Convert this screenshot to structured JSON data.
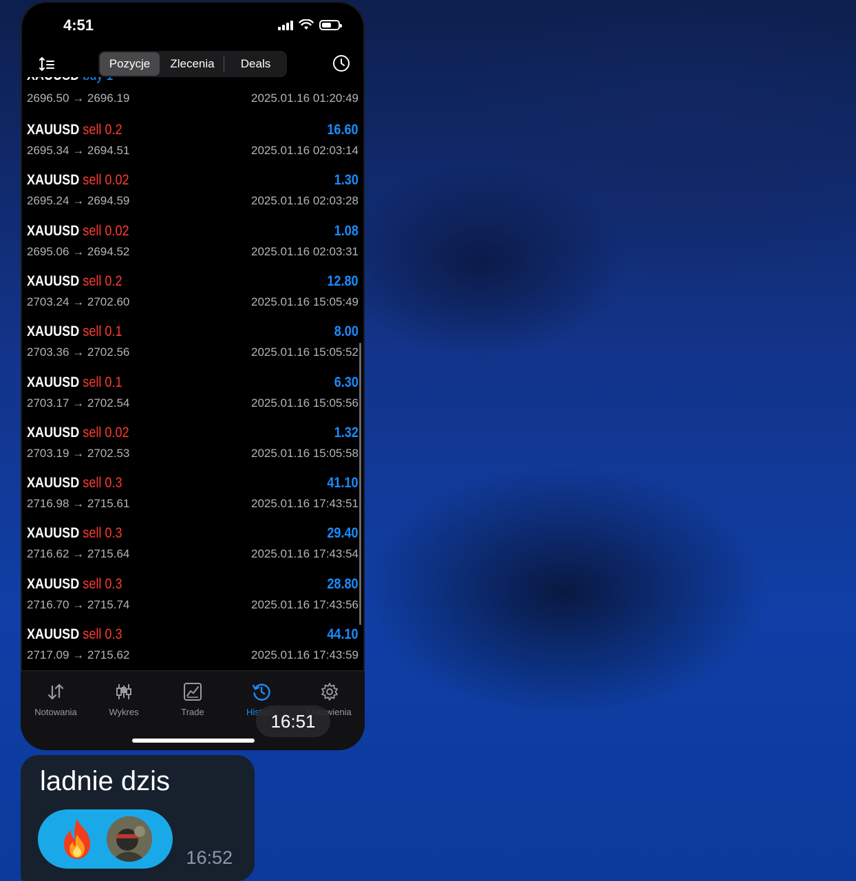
{
  "status_bar": {
    "time": "4:51"
  },
  "tabs": {
    "positions": "Pozycje",
    "orders": "Zlecenia",
    "deals": "Deals",
    "active": "Pozycje"
  },
  "trades": [
    {
      "symbol": "XAUUSD",
      "side": "sell",
      "volume": "0.2",
      "profit": "16.60",
      "prices": "2695.34 → 2694.51",
      "time": "2025.01.16 02:03:14"
    },
    {
      "symbol": "XAUUSD",
      "side": "sell",
      "volume": "0.02",
      "profit": "1.30",
      "prices": "2695.24 → 2694.59",
      "time": "2025.01.16 02:03:28"
    },
    {
      "symbol": "XAUUSD",
      "side": "sell",
      "volume": "0.02",
      "profit": "1.08",
      "prices": "2695.06 → 2694.52",
      "time": "2025.01.16 02:03:31"
    },
    {
      "symbol": "XAUUSD",
      "side": "sell",
      "volume": "0.2",
      "profit": "12.80",
      "prices": "2703.24 → 2702.60",
      "time": "2025.01.16 15:05:49"
    },
    {
      "symbol": "XAUUSD",
      "side": "sell",
      "volume": "0.1",
      "profit": "8.00",
      "prices": "2703.36 → 2702.56",
      "time": "2025.01.16 15:05:52"
    },
    {
      "symbol": "XAUUSD",
      "side": "sell",
      "volume": "0.1",
      "profit": "6.30",
      "prices": "2703.17 → 2702.54",
      "time": "2025.01.16 15:05:56"
    },
    {
      "symbol": "XAUUSD",
      "side": "sell",
      "volume": "0.02",
      "profit": "1.32",
      "prices": "2703.19 → 2702.53",
      "time": "2025.01.16 15:05:58"
    },
    {
      "symbol": "XAUUSD",
      "side": "sell",
      "volume": "0.3",
      "profit": "41.10",
      "prices": "2716.98 → 2715.61",
      "time": "2025.01.16 17:43:51"
    },
    {
      "symbol": "XAUUSD",
      "side": "sell",
      "volume": "0.3",
      "profit": "29.40",
      "prices": "2716.62 → 2715.64",
      "time": "2025.01.16 17:43:54"
    },
    {
      "symbol": "XAUUSD",
      "side": "sell",
      "volume": "0.3",
      "profit": "28.80",
      "prices": "2716.70 → 2715.74",
      "time": "2025.01.16 17:43:56"
    },
    {
      "symbol": "XAUUSD",
      "side": "sell",
      "volume": "0.3",
      "profit": "44.10",
      "prices": "2717.09 → 2715.62",
      "time": "2025.01.16 17:43:59"
    }
  ],
  "partial_trade": {
    "prices": "2696.50 → 2696.19",
    "time": "2025.01.16 01:20:49"
  },
  "bottom_nav": [
    {
      "label": "Notowania",
      "icon": "quotes-arrows-icon"
    },
    {
      "label": "Wykres",
      "icon": "candlestick-icon"
    },
    {
      "label": "Trade",
      "icon": "trade-chart-icon"
    },
    {
      "label": "Historia",
      "icon": "history-icon",
      "active": true
    },
    {
      "label": "Ustawienia",
      "icon": "gear-icon"
    }
  ],
  "screenshot_time": "16:51",
  "message": {
    "text": "ladnie dzis",
    "time": "16:52",
    "reaction": "🔥"
  },
  "colors": {
    "profit": "#1a8cff",
    "sell": "#ff3b30",
    "active_tab": "#1a8cff",
    "reaction_bg": "#1aa9e8",
    "bubble_bg": "#17202d"
  }
}
